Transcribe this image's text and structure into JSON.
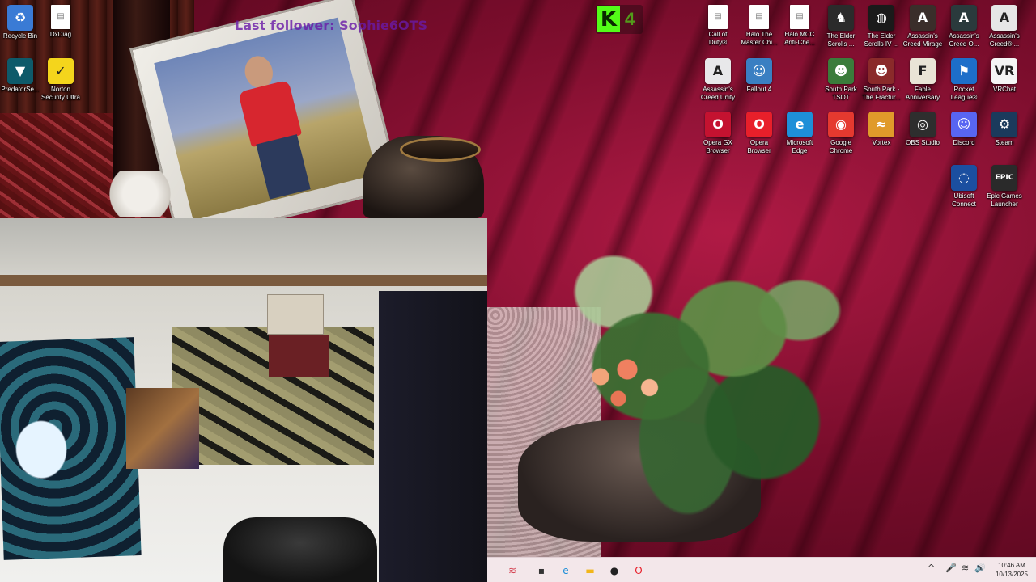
{
  "overlay": {
    "title": "Last follower: Sophie6OTS",
    "kick_logo": "K",
    "kick_count": "4"
  },
  "desktop_left": [
    {
      "label": "Recycle Bin",
      "icon": "recycle-bin-icon",
      "glyph": "♻",
      "color": "#3a7bd5"
    },
    {
      "label": "DxDiag",
      "icon": "document-icon",
      "glyph": "▤",
      "color": "#ffffff"
    },
    {
      "label": "PredatorSe...",
      "icon": "predator-sense-icon",
      "glyph": "▼",
      "color": "#0e5a6a"
    },
    {
      "label": "Norton\nSecurity Ultra",
      "icon": "norton-icon",
      "glyph": "✓",
      "color": "#f4d51c"
    }
  ],
  "desktop_right": [
    {
      "label": "Call of\nDuty®",
      "icon": "document-icon",
      "glyph": "▤",
      "color": "#ffffff"
    },
    {
      "label": "Halo The\nMaster Chi...",
      "icon": "document-icon",
      "glyph": "▤",
      "color": "#ffffff"
    },
    {
      "label": "Halo MCC\nAnti-Che...",
      "icon": "document-icon",
      "glyph": "▤",
      "color": "#ffffff"
    },
    {
      "label": "The Elder\nScrolls ...",
      "icon": "elder-scrolls-icon",
      "glyph": "♞",
      "color": "#2b2b2b"
    },
    {
      "label": "The Elder\nScrolls IV ...",
      "icon": "oblivion-icon",
      "glyph": "◍",
      "color": "#1a1a1a"
    },
    {
      "label": "Assassin's\nCreed Mirage",
      "icon": "assassins-creed-icon",
      "glyph": "A",
      "color": "#3a2e2a"
    },
    {
      "label": "Assassin's\nCreed O...",
      "icon": "assassins-creed-icon",
      "glyph": "A",
      "color": "#2a3a3c"
    },
    {
      "label": "Assassin's\nCreed® ...",
      "icon": "assassins-creed-icon",
      "glyph": "A",
      "color": "#e6e6e6"
    },
    {
      "label": "Assassin's\nCreed Unity",
      "icon": "assassins-creed-icon",
      "glyph": "A",
      "color": "#e8e8ea"
    },
    {
      "label": "Fallout 4",
      "icon": "fallout-icon",
      "glyph": "☺",
      "color": "#3a7fc2"
    },
    {
      "label": "South Park\nTSOT",
      "icon": "south-park-icon",
      "glyph": "☻",
      "color": "#3b7c3b"
    },
    {
      "label": "South Park -\nThe Fractur...",
      "icon": "south-park-icon",
      "glyph": "☻",
      "color": "#8a2a2a"
    },
    {
      "label": "Fable\nAnniversary",
      "icon": "fable-icon",
      "glyph": "F",
      "color": "#e9e4d6"
    },
    {
      "label": "Rocket\nLeague®",
      "icon": "rocket-league-icon",
      "glyph": "⚑",
      "color": "#1d6ec9"
    },
    {
      "label": "VRChat",
      "icon": "vrchat-icon",
      "glyph": "VR",
      "color": "#f5f5f5"
    },
    {
      "label": "Opera GX\nBrowser",
      "icon": "opera-gx-icon",
      "glyph": "O",
      "color": "#c41230"
    },
    {
      "label": "Opera\nBrowser",
      "icon": "opera-icon",
      "glyph": "O",
      "color": "#e81f2a"
    },
    {
      "label": "Microsoft\nEdge",
      "icon": "edge-icon",
      "glyph": "e",
      "color": "#1e8fd8"
    },
    {
      "label": "Google\nChrome",
      "icon": "chrome-icon",
      "glyph": "◉",
      "color": "#e5392f"
    },
    {
      "label": "Vortex",
      "icon": "vortex-icon",
      "glyph": "≈",
      "color": "#e09a2a"
    },
    {
      "label": "OBS Studio",
      "icon": "obs-icon",
      "glyph": "◎",
      "color": "#2e2e2e"
    },
    {
      "label": "Discord",
      "icon": "discord-icon",
      "glyph": "☺",
      "color": "#5865f2"
    },
    {
      "label": "Steam",
      "icon": "steam-icon",
      "glyph": "⚙",
      "color": "#1b3a5c"
    },
    {
      "label": "Ubisoft\nConnect",
      "icon": "ubisoft-icon",
      "glyph": "◌",
      "color": "#1b4fa0"
    },
    {
      "label": "Epic Games\nLauncher",
      "icon": "epic-games-icon",
      "glyph": "EPIC",
      "color": "#2a2a2a"
    }
  ],
  "taskbar": {
    "items": [
      {
        "icon": "widgets-icon",
        "glyph": "≋",
        "color": "#d23a4a"
      },
      {
        "icon": "task-view-icon",
        "glyph": "▪",
        "color": "#333333"
      },
      {
        "icon": "edge-icon",
        "glyph": "e",
        "color": "#1e8fd8"
      },
      {
        "icon": "file-explorer-icon",
        "glyph": "▬",
        "color": "#f2b619"
      },
      {
        "icon": "app-icon",
        "glyph": "●",
        "color": "#222222"
      },
      {
        "icon": "opera-icon",
        "glyph": "O",
        "color": "#e81f2a"
      }
    ],
    "tray": {
      "chevron": "^",
      "mic": "🎤",
      "wifi": "≋",
      "volume": "🔊"
    },
    "time": "10:46 AM",
    "date": "10/13/2025"
  }
}
